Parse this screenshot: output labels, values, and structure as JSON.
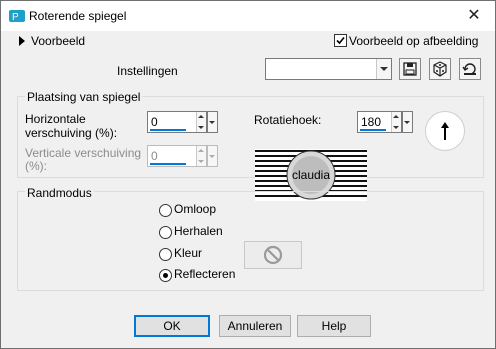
{
  "window": {
    "title": "Roterende spiegel",
    "close_glyph": "✕"
  },
  "preview": {
    "toggle_label": "Voorbeeld",
    "checkbox_label": "Voorbeeld op afbeelding",
    "checkbox_checked": true
  },
  "settings": {
    "label": "Instellingen",
    "value": ""
  },
  "placement": {
    "group_label": "Plaatsing van spiegel",
    "horizontal": {
      "label_line1": "Horizontale",
      "label_line2": "verschuiving (%):",
      "value": "0"
    },
    "vertical": {
      "label_line1": "Verticale verschuiving",
      "label_line2": "(%):",
      "value": "0",
      "enabled": false
    },
    "rotation": {
      "label": "Rotatiehoek:",
      "value": "180"
    },
    "watermark_text": "claudia"
  },
  "edge_mode": {
    "group_label": "Randmodus",
    "options": [
      "Omloop",
      "Herhalen",
      "Kleur",
      "Reflecteren"
    ],
    "selected": "Reflecteren"
  },
  "buttons": {
    "ok": "OK",
    "cancel": "Annuleren",
    "help": "Help"
  },
  "icons": [
    "app-icon",
    "close-icon",
    "caret-right-icon",
    "checkbox-icon",
    "save-preset-icon",
    "random-preset-icon",
    "reset-preset-icon",
    "rotation-dial-icon",
    "no-color-icon"
  ]
}
